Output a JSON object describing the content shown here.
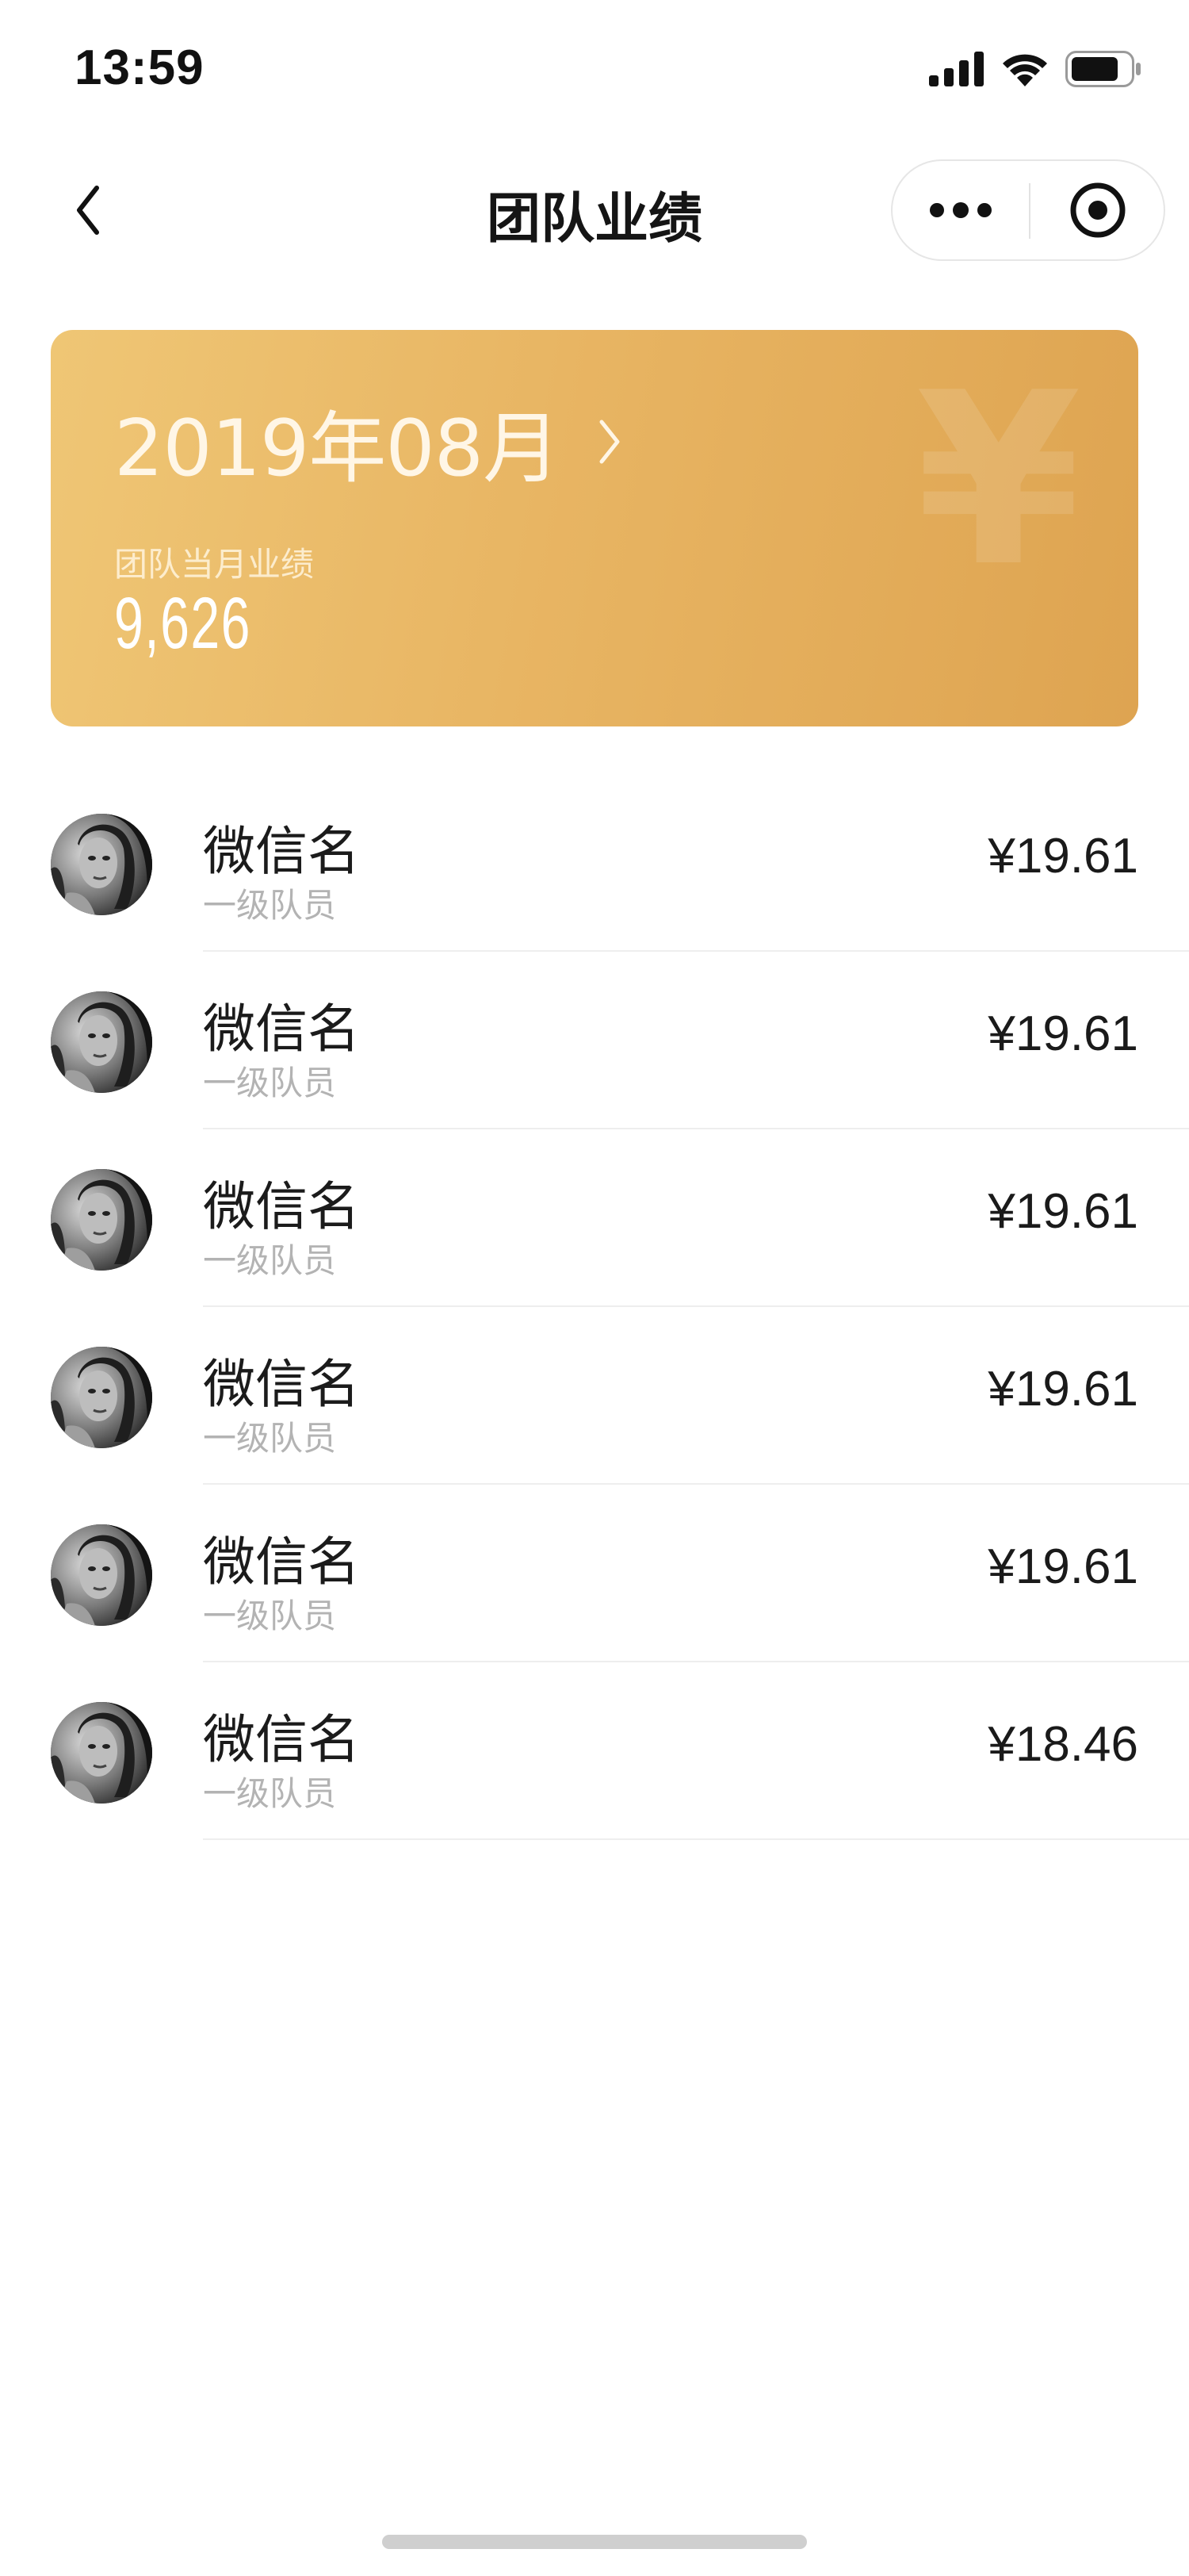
{
  "status_bar": {
    "time": "13:59"
  },
  "nav": {
    "title": "团队业绩"
  },
  "summary": {
    "month": "2019年08月",
    "label": "团队当月业绩",
    "value": "9,626",
    "watermark": "¥"
  },
  "members": [
    {
      "name": "微信名",
      "level": "一级队员",
      "amount": "¥19.61"
    },
    {
      "name": "微信名",
      "level": "一级队员",
      "amount": "¥19.61"
    },
    {
      "name": "微信名",
      "level": "一级队员",
      "amount": "¥19.61"
    },
    {
      "name": "微信名",
      "level": "一级队员",
      "amount": "¥19.61"
    },
    {
      "name": "微信名",
      "level": "一级队员",
      "amount": "¥19.61"
    },
    {
      "name": "微信名",
      "level": "一级队员",
      "amount": "¥18.46"
    }
  ],
  "icons": {
    "back": "chevron-left-icon",
    "more": "more-dots-icon",
    "close": "target-close-icon",
    "month_arrow": "chevron-right-icon"
  },
  "colors": {
    "card_start": "#efc675",
    "card_end": "#dea451",
    "text_primary": "#1a1a1a",
    "text_secondary": "#b3b3b3"
  }
}
